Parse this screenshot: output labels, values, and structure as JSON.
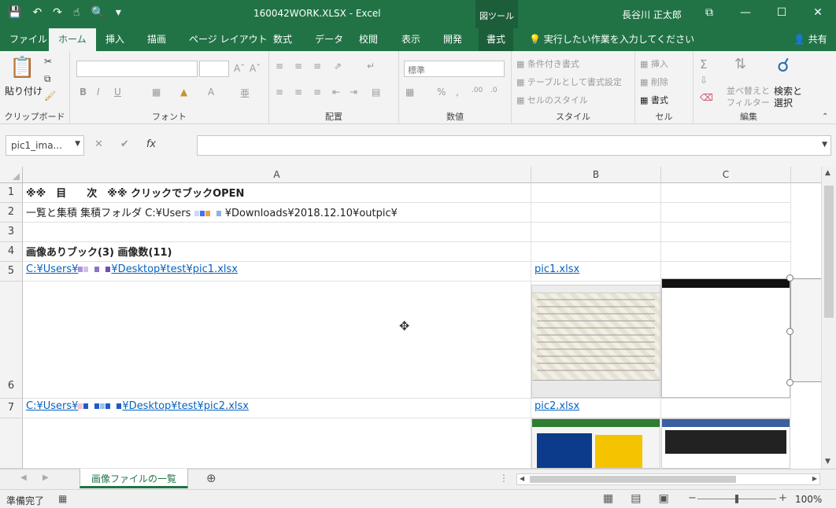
{
  "window": {
    "title": "160042WORK.XLSX - Excel",
    "contextual_tools": "図ツール",
    "user": "長谷川 正太郎",
    "controls": [
      "⧉",
      "—",
      "☐",
      "✕"
    ]
  },
  "ribbon_tabs": [
    "ファイル",
    "ホーム",
    "挿入",
    "描画",
    "ページ レイアウト",
    "数式",
    "データ",
    "校閲",
    "表示",
    "開発",
    "書式"
  ],
  "tell_me": "実行したい作業を入力してください",
  "share": "共有",
  "groups": {
    "clipboard": {
      "label": "クリップボード",
      "paste": "貼り付け"
    },
    "font": {
      "label": "フォント",
      "bold": "B",
      "italic": "I",
      "underline": "U"
    },
    "alignment": {
      "label": "配置"
    },
    "number": {
      "label": "数値",
      "format": "標準",
      "percent": "%"
    },
    "styles": {
      "label": "スタイル",
      "conditional": "条件付き書式",
      "as_table": "テーブルとして書式設定",
      "cell_styles": "セルのスタイル"
    },
    "cells": {
      "label": "セル",
      "insert": "挿入",
      "delete": "削除",
      "format": "書式"
    },
    "editing": {
      "label": "編集",
      "sort_filter_1": "並べ替えと",
      "sort_filter_2": "フィルター",
      "find_1": "検索と",
      "find_2": "選択"
    }
  },
  "formula_bar": {
    "name_box": "pic1_ima...",
    "cancel": "✕",
    "enter": "✔",
    "fx": "fx"
  },
  "columns": [
    "A",
    "B",
    "C"
  ],
  "rows": [
    "1",
    "2",
    "3",
    "4",
    "5",
    "6",
    "7"
  ],
  "cells": {
    "A1": "※※　目　　次　※※ クリックでブックOPEN",
    "A2_prefix": "一覧と集積 集積フォルダ C:¥Users",
    "A2_suffix": "¥Downloads¥2018.12.10¥outpic¥",
    "A4": "画像ありブック(3) 画像数(11)",
    "A5_prefix": "C:¥Users¥",
    "A5_suffix": "¥Desktop¥test¥pic1.xlsx",
    "B5": "pic1.xlsx",
    "A7_prefix": "C:¥Users¥",
    "A7_suffix": "¥Desktop¥test¥pic2.xlsx",
    "B7": "pic2.xlsx"
  },
  "sheet_tab": "画像ファイルの一覧",
  "status": "準備完了",
  "zoom": "100%",
  "accent_color": "#217346"
}
